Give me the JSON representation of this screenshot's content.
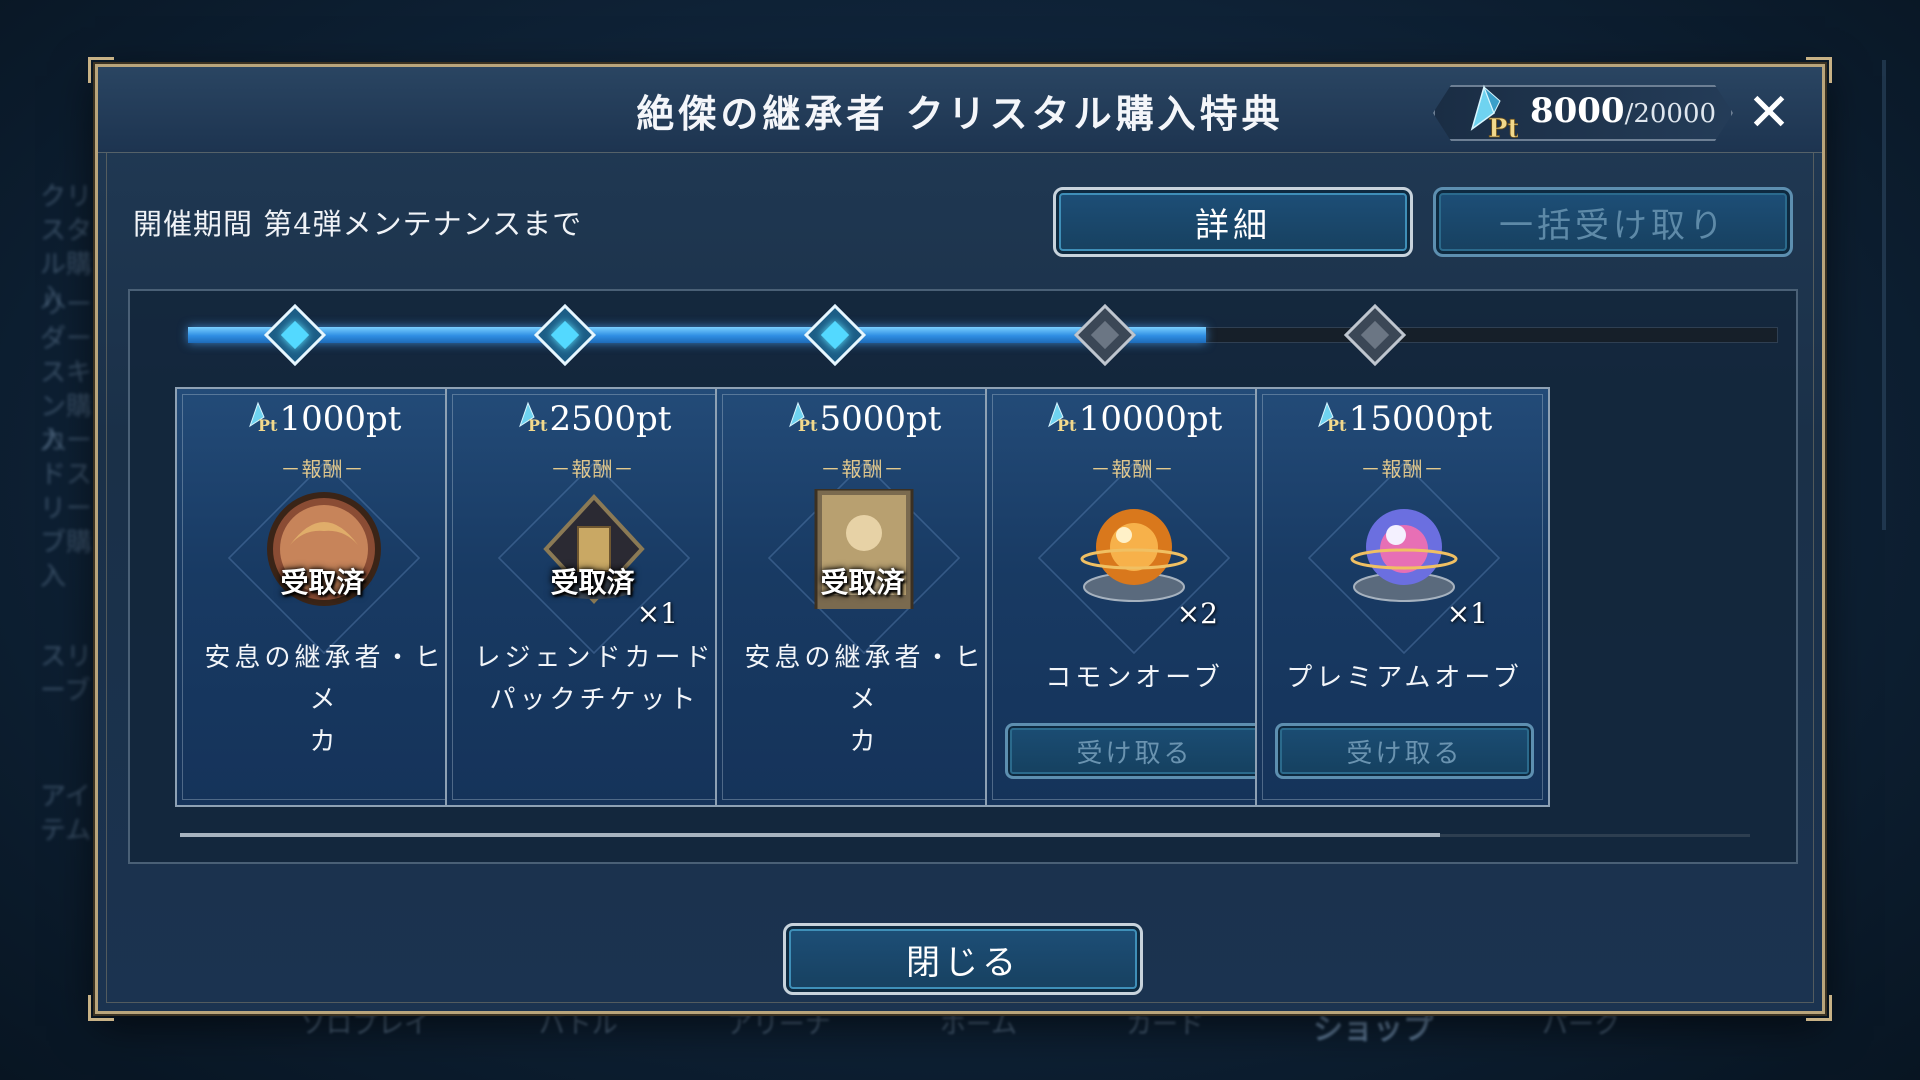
{
  "background": {
    "side_items": [
      "クリスタル購入",
      "リーダースキン購入",
      "カードスリーブ購入",
      "スリーブ",
      "アイテム"
    ],
    "nav_items": [
      "ソロプレイ",
      "バトル",
      "アリーナ",
      "ホーム",
      "カード",
      "ショップ",
      "パーク"
    ],
    "active_nav": "ショップ"
  },
  "dialog": {
    "title": "絶傑の継承者 クリスタル購入特典",
    "points": {
      "current": "8000",
      "separator_total": "/20000",
      "icon": "pt-crystal-icon"
    },
    "close_icon": "close-icon",
    "period": "開催期間 第4弾メンテナンスまで",
    "detail_button": "詳細",
    "bulk_claim_button": "一括受け取り",
    "close_button": "閉じる",
    "progress": {
      "current": 8000,
      "total": 20000,
      "fill_fraction_of_track": 0.64
    },
    "rewards": [
      {
        "pt": "1000pt",
        "reward_label": "－報酬－",
        "item_icon": "hime-card-avatar-icon",
        "status": "受取済",
        "qty": "",
        "name_lines": [
          "安息の継承者・ヒメ",
          "カ"
        ],
        "claimed": true
      },
      {
        "pt": "2500pt",
        "reward_label": "－報酬－",
        "item_icon": "legend-card-pack-ticket-icon",
        "status": "受取済",
        "qty": "×1",
        "name_lines": [
          "レジェンドカード",
          "パックチケット"
        ],
        "claimed": true
      },
      {
        "pt": "5000pt",
        "reward_label": "－報酬－",
        "item_icon": "hime-card-art-icon",
        "status": "受取済",
        "qty": "",
        "name_lines": [
          "安息の継承者・ヒメ",
          "カ"
        ],
        "claimed": true
      },
      {
        "pt": "10000pt",
        "reward_label": "－報酬－",
        "item_icon": "common-orb-icon",
        "status": "",
        "qty": "×2",
        "name_lines": [
          "コモンオーブ"
        ],
        "claimed": false,
        "claim_button": "受け取る"
      },
      {
        "pt": "15000pt",
        "reward_label": "－報酬－",
        "item_icon": "premium-orb-icon",
        "status": "",
        "qty": "×1",
        "name_lines": [
          "プレミアムオーブ"
        ],
        "claimed": false,
        "claim_button": "受け取る"
      }
    ]
  },
  "colors": {
    "accent_blue": "#2f8ee3",
    "gold_frame": "#b9a57c",
    "reward_label": "#e3c98d",
    "disabled_button_text": "#6a93b0"
  }
}
